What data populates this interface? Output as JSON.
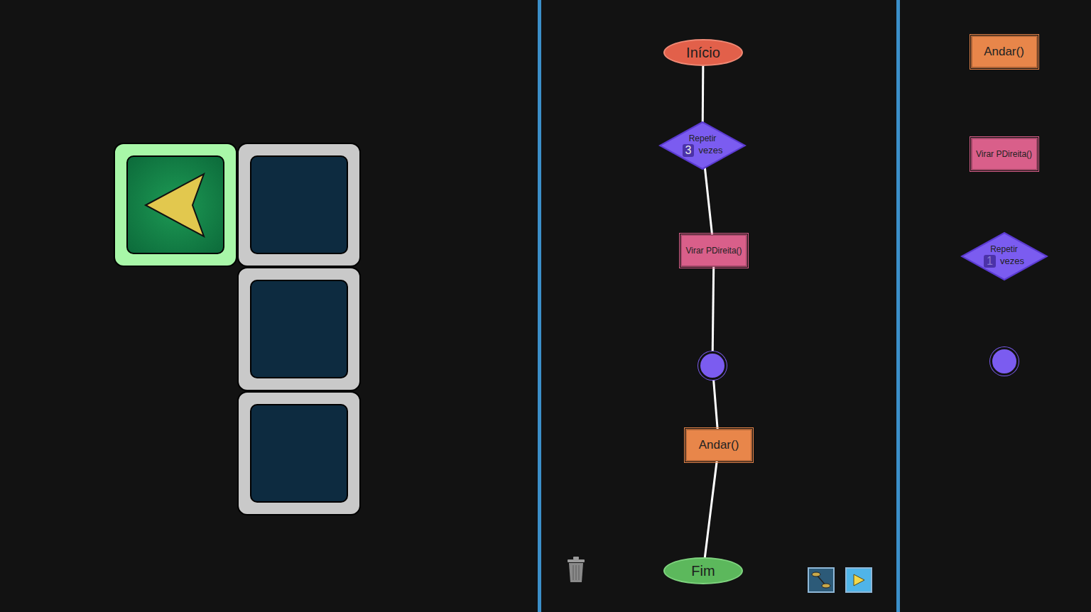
{
  "board": {
    "rows": [
      [
        {
          "kind": "start",
          "selected": true,
          "facing": "left"
        },
        {
          "kind": "path",
          "selected": false
        }
      ],
      [
        {
          "kind": "empty",
          "selected": false
        },
        {
          "kind": "path",
          "selected": false
        }
      ],
      [
        {
          "kind": "empty",
          "selected": false
        },
        {
          "kind": "path",
          "selected": false
        }
      ]
    ]
  },
  "flowchart": {
    "nodes": [
      {
        "kind": "start",
        "label": "Início"
      },
      {
        "kind": "loop",
        "label": "Repetir",
        "count": "3",
        "unit": "vezes"
      },
      {
        "kind": "action",
        "label": "Virar PDireita()",
        "color": "#d95f8a"
      },
      {
        "kind": "join"
      },
      {
        "kind": "action",
        "label": "Andar()",
        "color": "#e8864a"
      },
      {
        "kind": "end",
        "label": "Fim"
      }
    ]
  },
  "palette": [
    {
      "kind": "action",
      "label": "Andar()",
      "color": "#e8864a"
    },
    {
      "kind": "action",
      "label": "Virar PDireita()",
      "color": "#d95f8a"
    },
    {
      "kind": "loop",
      "label": "Repetir",
      "count": "1",
      "unit": "vezes"
    },
    {
      "kind": "join"
    }
  ]
}
